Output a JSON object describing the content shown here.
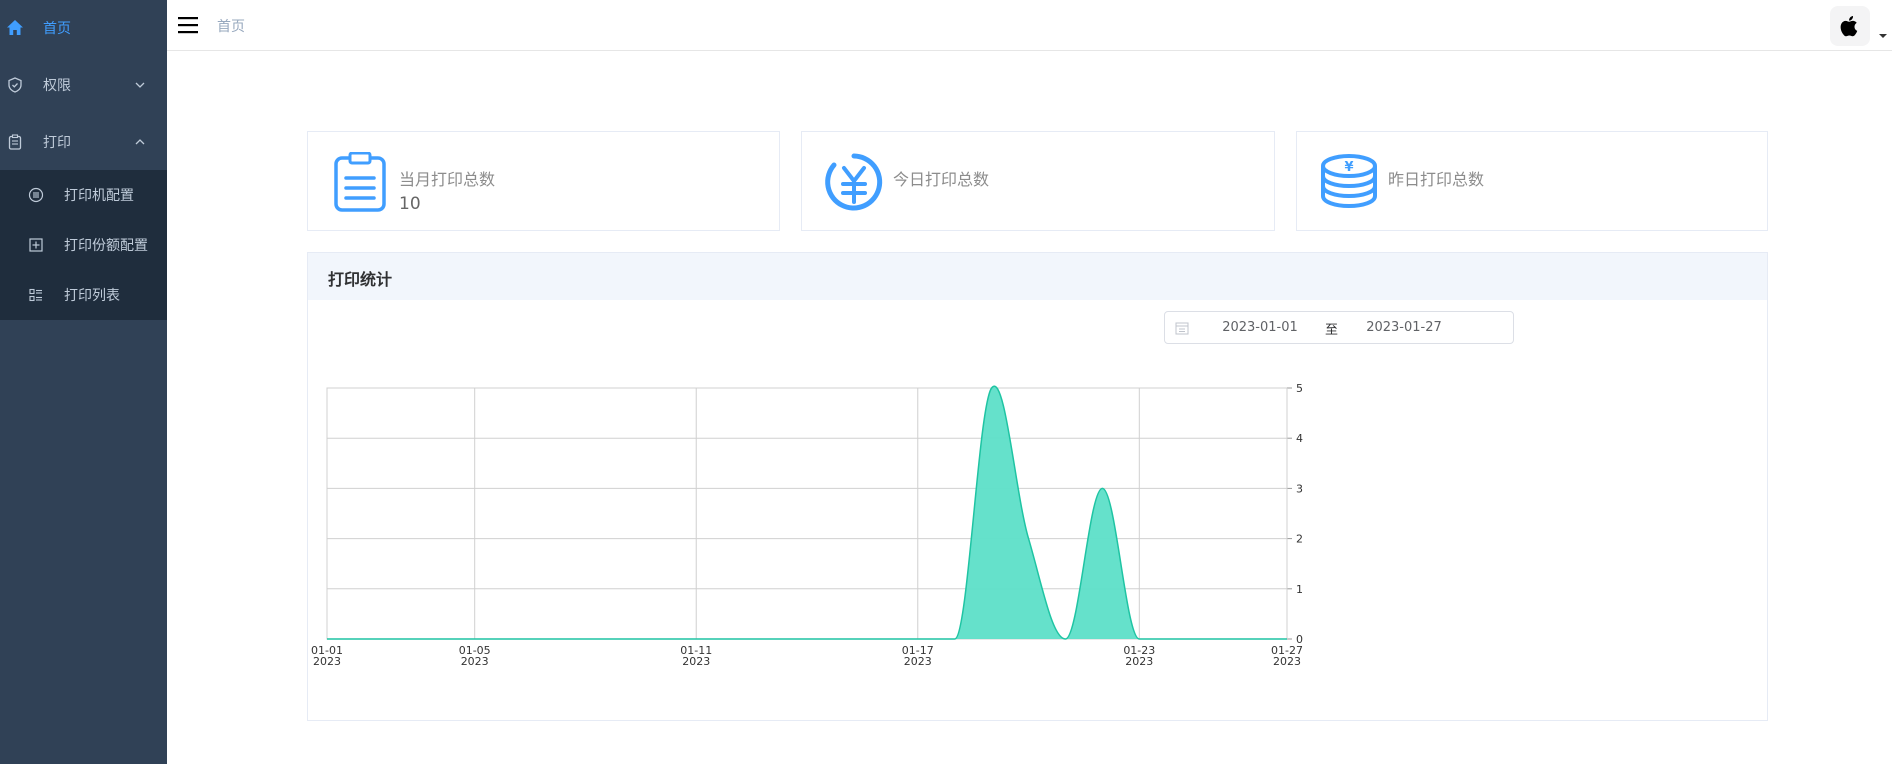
{
  "sidebar": {
    "home": {
      "label": "首页",
      "icon": "home-icon"
    },
    "permissions": {
      "label": "权限",
      "icon": "shield-icon"
    },
    "print": {
      "label": "打印",
      "icon": "clipboard-icon"
    },
    "print_items": [
      {
        "label": "打印机配置",
        "icon": "list-circle-icon"
      },
      {
        "label": "打印份额配置",
        "icon": "plus-square-icon"
      },
      {
        "label": "打印列表",
        "icon": "list-icon"
      }
    ]
  },
  "header": {
    "breadcrumb": "首页",
    "avatar_icon": "apple-icon"
  },
  "cards": [
    {
      "title": "当月打印总数",
      "value": "10",
      "icon": "clipboard-icon"
    },
    {
      "title": "今日打印总数",
      "value": "",
      "icon": "yen-circle-icon"
    },
    {
      "title": "昨日打印总数",
      "value": "",
      "icon": "coins-icon"
    }
  ],
  "panel": {
    "title": "打印统计",
    "date_start": "2023-01-01",
    "date_separator": "至",
    "date_end": "2023-01-27"
  },
  "colors": {
    "accent": "#409eff",
    "series_fill": "#5ddfc8",
    "series_line": "#1fc4a3",
    "sidebar_bg": "#304156"
  },
  "chart_data": {
    "type": "area",
    "x": [
      "2023-01-01",
      "2023-01-02",
      "2023-01-03",
      "2023-01-04",
      "2023-01-05",
      "2023-01-06",
      "2023-01-07",
      "2023-01-08",
      "2023-01-09",
      "2023-01-10",
      "2023-01-11",
      "2023-01-12",
      "2023-01-13",
      "2023-01-14",
      "2023-01-15",
      "2023-01-16",
      "2023-01-17",
      "2023-01-18",
      "2023-01-19",
      "2023-01-20",
      "2023-01-21",
      "2023-01-22",
      "2023-01-23",
      "2023-01-24",
      "2023-01-25",
      "2023-01-26",
      "2023-01-27"
    ],
    "series": [
      {
        "values": [
          0,
          0,
          0,
          0,
          0,
          0,
          0,
          0,
          0,
          0,
          0,
          0,
          0,
          0,
          0,
          0,
          0,
          0,
          5,
          2,
          0,
          3,
          0,
          0,
          0,
          0,
          0
        ]
      }
    ],
    "ylim": [
      0,
      5
    ],
    "y_ticks": [
      0,
      1,
      2,
      3,
      4,
      5
    ],
    "x_tick_labels": [
      {
        "date": "01-01",
        "year": "2023"
      },
      {
        "date": "01-05",
        "year": "2023"
      },
      {
        "date": "01-11",
        "year": "2023"
      },
      {
        "date": "01-17",
        "year": "2023"
      },
      {
        "date": "01-23",
        "year": "2023"
      },
      {
        "date": "01-27",
        "year": "2023"
      }
    ],
    "y_axis_side": "right",
    "grid": true
  }
}
